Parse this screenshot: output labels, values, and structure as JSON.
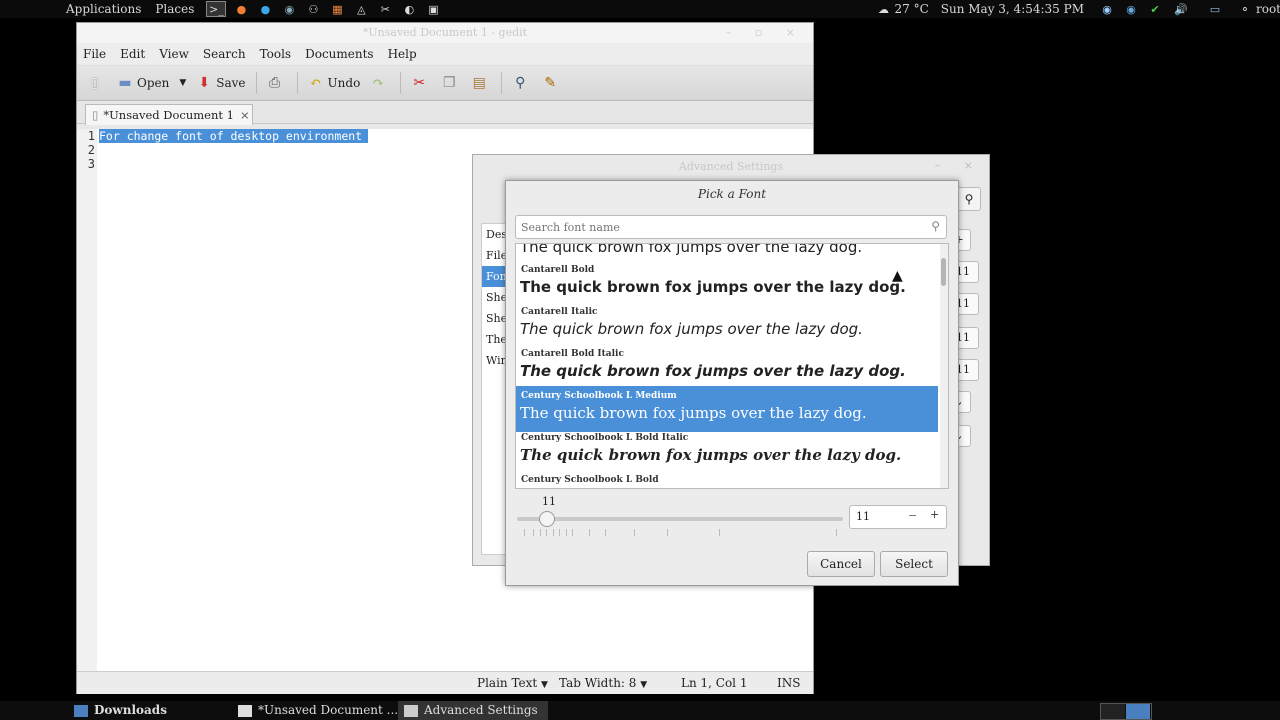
{
  "top_panel": {
    "applications": "Applications",
    "places": "Places",
    "weather": "27 °C",
    "clock": "Sun May  3,  4:54:35 PM",
    "user": "root"
  },
  "gedit": {
    "title": "*Unsaved Document 1 - gedit",
    "menu": [
      "File",
      "Edit",
      "View",
      "Search",
      "Tools",
      "Documents",
      "Help"
    ],
    "toolbar": {
      "open": "Open",
      "save": "Save",
      "undo": "Undo"
    },
    "tab_label": "*Unsaved Document 1",
    "line_numbers": [
      "1",
      "2",
      "3"
    ],
    "lines": [
      "For change font of desktop environment",
      "",
      ""
    ],
    "status": {
      "language": "Plain Text",
      "tab_width": "Tab Width:  8",
      "position": "Ln 1, Col 1",
      "mode": "INS"
    }
  },
  "advanced_settings": {
    "title": "Advanced Settings",
    "sidebar": [
      "Desktop",
      "Files",
      "Fonts",
      "Shell",
      "Shell Extensions",
      "Theme",
      "Windows"
    ],
    "selected": "Fonts",
    "spin_values": [
      "11",
      "11",
      "11",
      "11"
    ]
  },
  "font_dialog": {
    "title": "Pick a Font",
    "search_placeholder": "Search font name",
    "sample": "The quick brown fox jumps over the lazy dog.",
    "fonts": [
      {
        "name": "",
        "style": "normal"
      },
      {
        "name": "Cantarell Bold",
        "style": "bold"
      },
      {
        "name": "Cantarell Italic",
        "style": "italic"
      },
      {
        "name": "Cantarell Bold Italic",
        "style": "bolditalic"
      },
      {
        "name": "Century Schoolbook L Medium",
        "style": "serif"
      },
      {
        "name": "Century Schoolbook L Bold Italic",
        "style": "serifbolditalic"
      },
      {
        "name": "Century Schoolbook L Bold",
        "style": "serifbold"
      }
    ],
    "selected_font": "Century Schoolbook L Medium",
    "size": "11",
    "size_fraction": 0.09,
    "cancel": "Cancel",
    "select": "Select"
  },
  "taskbar": {
    "downloads": "Downloads",
    "gedit_task": "*Unsaved Document ...",
    "settings_task": "Advanced Settings"
  },
  "colors": {
    "selection": "#4a90d9",
    "panel": "#0b0b0b"
  }
}
